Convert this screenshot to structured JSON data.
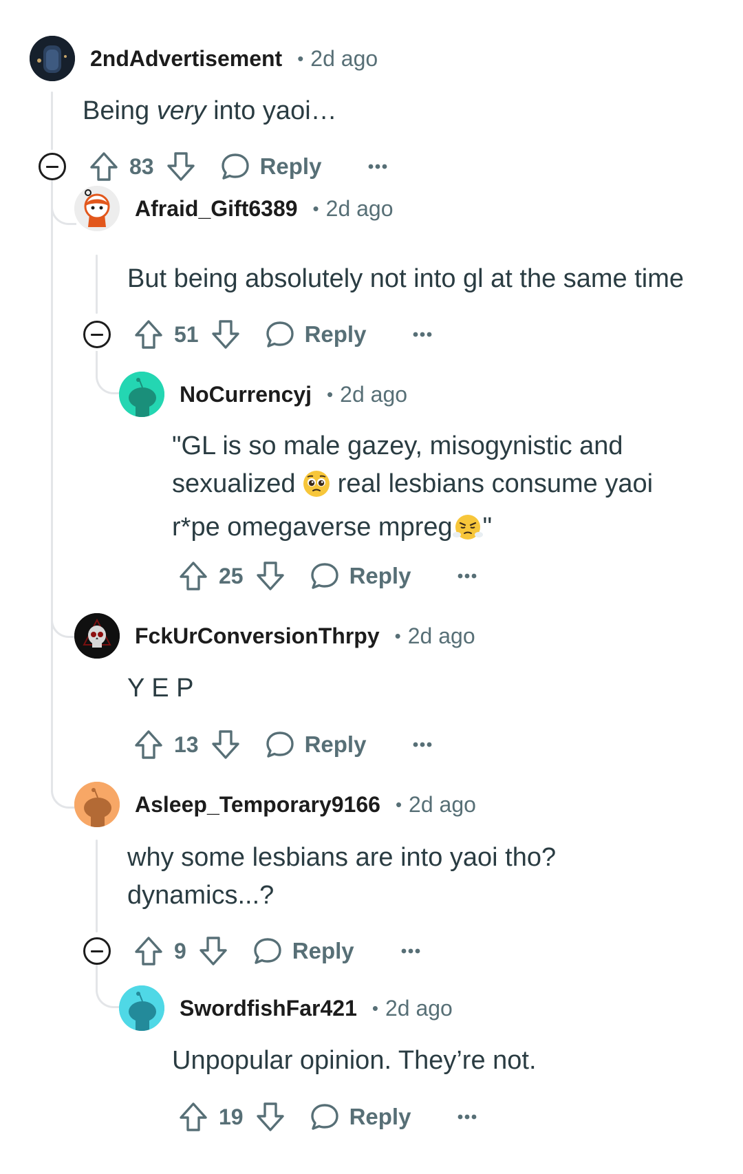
{
  "comments": [
    {
      "username": "2ndAdvertisement",
      "separator": "•",
      "age": "2d ago",
      "body_pre": "Being ",
      "body_em": "very",
      "body_post": " into yaoi…",
      "votes": "83",
      "reply_label": "Reply",
      "avatar_color": "#1a2331"
    },
    {
      "username": "Afraid_Gift6389",
      "separator": "•",
      "age": "2d ago",
      "body": "But being absolutely not into gl at the same time",
      "votes": "51",
      "reply_label": "Reply",
      "avatar_color": "#f3f3f3"
    },
    {
      "username": "NoCurrencyj",
      "separator": "•",
      "age": "2d ago",
      "body_line1": "\"GL is so male gazey, misogynistic and",
      "body_line2_pre": "sexualized ",
      "body_line2_post": " real lesbians consume yaoi",
      "body_line3_pre": "r*pe omegaverse mpreg",
      "body_line3_post": "\"",
      "votes": "25",
      "reply_label": "Reply",
      "avatar_color": "#24d6b2"
    },
    {
      "username": "FckUrConversionThrpy",
      "separator": "•",
      "age": "2d ago",
      "body": "Y E P",
      "votes": "13",
      "reply_label": "Reply",
      "avatar_color": "#111111"
    },
    {
      "username": "Asleep_Temporary9166",
      "separator": "•",
      "age": "2d ago",
      "body_line1": "why some lesbians are into yaoi tho?",
      "body_line2": "dynamics...?",
      "votes": "9",
      "reply_label": "Reply",
      "avatar_color": "#f7a766"
    },
    {
      "username": "SwordfishFar421",
      "separator": "•",
      "age": "2d ago",
      "body": "Unpopular opinion. They’re not.",
      "votes": "19",
      "reply_label": "Reply",
      "avatar_color": "#4fd8e6"
    }
  ],
  "icons": {
    "upvote": "upvote-arrow-icon",
    "downvote": "downvote-arrow-icon",
    "reply": "speech-bubble-icon",
    "more": "ellipsis-icon",
    "collapse": "collapse-minus-icon",
    "emoji_pleading": "pleading-face-emoji",
    "emoji_angry": "face-with-steam-emoji"
  },
  "colors": {
    "text_primary": "#1c1c1c",
    "text_secondary": "#576f76",
    "thread_line": "#e3e5e8"
  }
}
